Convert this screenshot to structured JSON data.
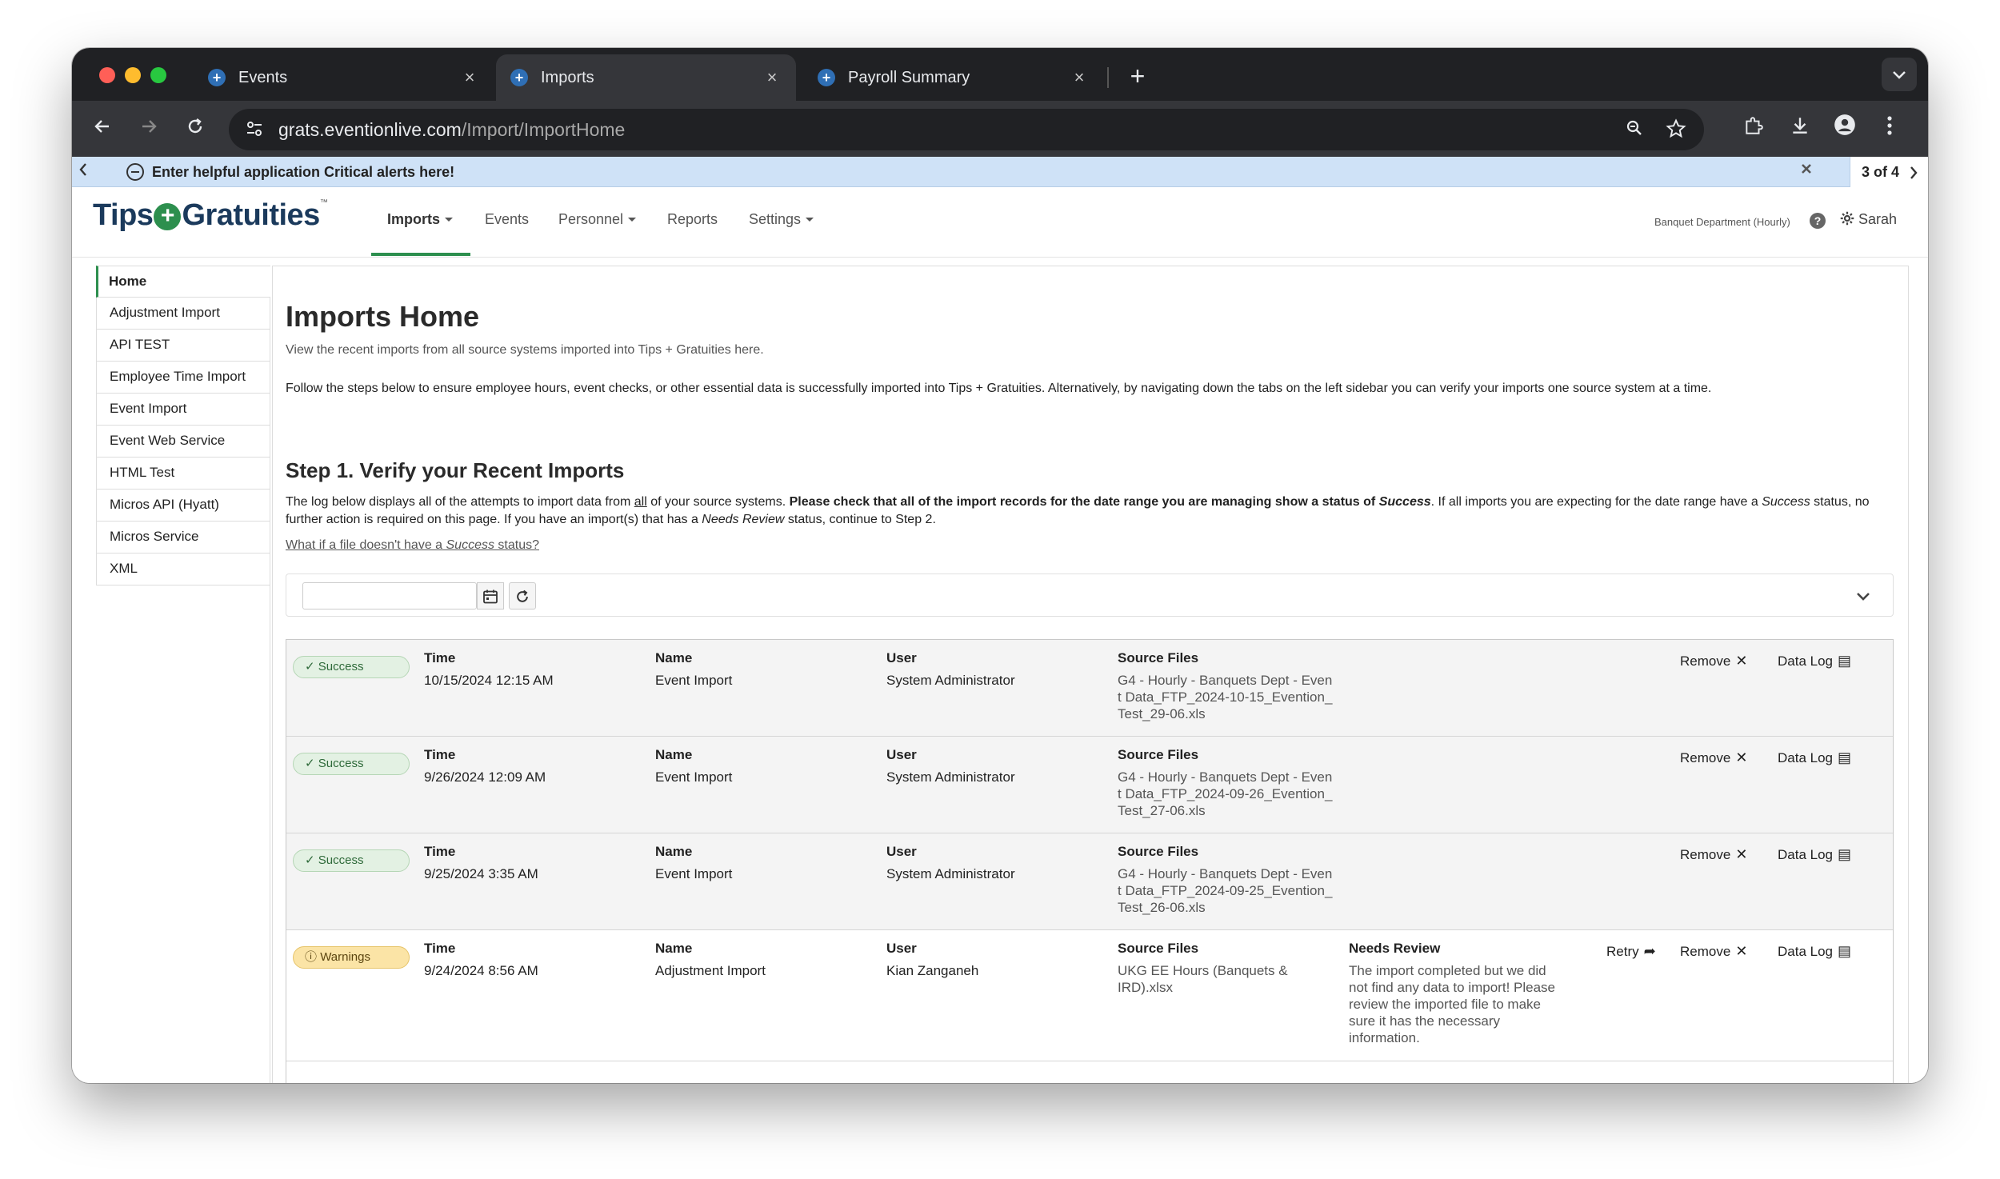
{
  "browser": {
    "tabs": [
      {
        "label": "Events",
        "favicon": "+",
        "active": false
      },
      {
        "label": "Imports",
        "favicon": "+",
        "active": true
      },
      {
        "label": "Payroll Summary",
        "favicon": "+",
        "active": false
      }
    ],
    "close_glyph": "×",
    "new_tab_glyph": "+",
    "url_host": "grats.eventionlive.com",
    "url_path": "/Import/ImportHome",
    "icons": {
      "back": "back-arrow-icon",
      "forward": "forward-arrow-icon",
      "reload": "reload-icon",
      "site_info": "site-info-icon",
      "zoom": "zoom-icon",
      "bookmark": "star-icon",
      "extensions": "puzzle-icon",
      "download": "download-icon",
      "profile": "profile-icon",
      "menu": "kebab-menu-icon",
      "tab_search": "chevron-down-icon"
    }
  },
  "alert": {
    "message": "Enter helpful application Critical alerts here!",
    "counter": "3 of 4"
  },
  "app": {
    "logo_part1": "Tips",
    "logo_plus": "+",
    "logo_part2": "Gratuities",
    "logo_tm": "™",
    "menu": [
      {
        "label": "Imports",
        "active": true,
        "dropdown": true
      },
      {
        "label": "Events",
        "active": false,
        "dropdown": false
      },
      {
        "label": "Personnel",
        "active": false,
        "dropdown": true
      },
      {
        "label": "Reports",
        "active": false,
        "dropdown": false
      },
      {
        "label": "Settings",
        "active": false,
        "dropdown": true
      }
    ],
    "department": "Banquet Department (Hourly)",
    "help_glyph": "?",
    "user": "Sarah",
    "accent_color": "#2d8f4e"
  },
  "sidebar": {
    "items": [
      {
        "label": "Home",
        "active": true
      },
      {
        "label": "Adjustment Import",
        "active": false
      },
      {
        "label": "API TEST",
        "active": false
      },
      {
        "label": "Employee Time Import",
        "active": false
      },
      {
        "label": "Event Import",
        "active": false
      },
      {
        "label": "Event Web Service",
        "active": false
      },
      {
        "label": "HTML Test",
        "active": false
      },
      {
        "label": "Micros API (Hyatt)",
        "active": false
      },
      {
        "label": "Micros Service",
        "active": false
      },
      {
        "label": "XML",
        "active": false
      }
    ]
  },
  "main": {
    "title": "Imports Home",
    "subtitle": "View the recent imports from all source systems imported into Tips + Gratuities here.",
    "intro": "Follow the steps below to ensure employee hours, event checks, or other essential data is successfully imported into Tips + Gratuities. Alternatively, by navigating down the tabs on the left sidebar you can verify your imports one source system at a time.",
    "step1_title": "Step 1. Verify your Recent Imports",
    "step1_p1": "The log below displays all of the attempts to import data from ",
    "step1_all": "all",
    "step1_p2": " of your source systems. ",
    "step1_bold": "Please check that all of the import records for the date range you are managing show a status of ",
    "step1_bold_em": "Success",
    "step1_p3": ". If all imports you are expecting for the date range have a ",
    "step1_success": "Success",
    "step1_p4": " status, no further action is required on this page. If you have an import(s) that has a ",
    "step1_needs": "Needs Review",
    "step1_p5": " status, continue to Step 2.",
    "faq_p1": "What if a file doesn't have a ",
    "faq_em": "Success",
    "faq_p2": " status?",
    "date_value": "",
    "calendar_glyph": "▦",
    "refresh_glyph": "↻",
    "expand_glyph": "⌄"
  },
  "imports": {
    "labels": {
      "time": "Time",
      "name": "Name",
      "user": "User",
      "source": "Source Files",
      "review": "Needs Review",
      "retry": "Retry",
      "remove": "Remove",
      "datalog": "Data Log"
    },
    "glyphs": {
      "retry": "➦",
      "remove": "✕",
      "datalog": "▤",
      "success": "✓",
      "warning": "ⓘ"
    },
    "rows": [
      {
        "status": "Success",
        "status_type": "success",
        "time": "10/15/2024 12:15 AM",
        "name": "Event Import",
        "user": "System Administrator",
        "source": "G4 - Hourly - Banquets Dept - Event Data_FTP_2024-10-15_Evention_Test_29-06.xls"
      },
      {
        "status": "Success",
        "status_type": "success",
        "time": "9/26/2024 12:09 AM",
        "name": "Event Import",
        "user": "System Administrator",
        "source": "G4 - Hourly - Banquets Dept - Event Data_FTP_2024-09-26_Evention_Test_27-06.xls"
      },
      {
        "status": "Success",
        "status_type": "success",
        "time": "9/25/2024 3:35 AM",
        "name": "Event Import",
        "user": "System Administrator",
        "source": "G4 - Hourly - Banquets Dept - Event Data_FTP_2024-09-25_Evention_Test_26-06.xls"
      },
      {
        "status": "Warnings",
        "status_type": "warning",
        "time": "9/24/2024 8:56 AM",
        "name": "Adjustment Import",
        "user": "Kian Zanganeh",
        "source": "UKG EE Hours (Banquets & IRD).xlsx",
        "review": "The import completed but we did not find any data to import! Please review the imported file to make sure it has the necessary information."
      }
    ]
  }
}
